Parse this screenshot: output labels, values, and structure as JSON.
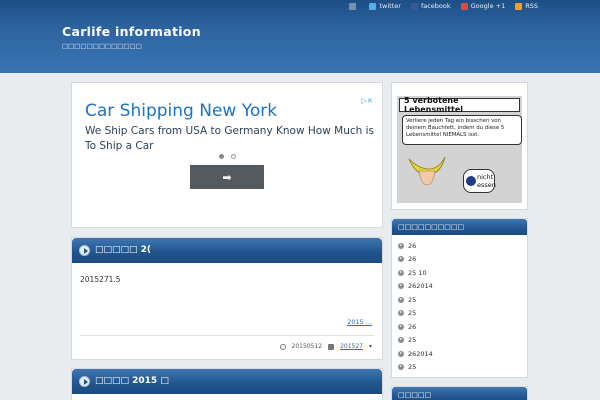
{
  "site": {
    "title": "Carlife information",
    "description": "□□□□□□□□□□□□□"
  },
  "topbar": [
    {
      "label": "",
      "icon": "rss-square-icon",
      "color": "#7a8fa8"
    },
    {
      "label": "twitter",
      "icon": "twitter-icon",
      "color": "#55acee"
    },
    {
      "label": "facebook",
      "icon": "facebook-icon",
      "color": "#3b5998"
    },
    {
      "label": "Google +1",
      "icon": "google-plus-icon",
      "color": "#dd4b39"
    },
    {
      "label": "RSS",
      "icon": "rss-icon",
      "color": "#f59d2a"
    }
  ],
  "ad": {
    "title": "Car Shipping New York",
    "body": "We Ship Cars from USA to Germany Know How Much is To Ship a Car",
    "button_label": "➡",
    "choice_label": "▷✕"
  },
  "article": {
    "title": "□□□□□ 2(",
    "text": "2015271.5",
    "more_link": "2015 ...",
    "date": "20150512",
    "tag": "201527",
    "tag_suffix": "▾"
  },
  "article2": {
    "title": "□□□□ 2015 □"
  },
  "side_ad": {
    "title": "5 verbotene Lebensmittel",
    "text": "Verliere jeden Tag ein bisschen von deinem Bauchfett, indem du diese 5 Lebensmittel NIEMALS isst.",
    "cta": "nicht essen"
  },
  "widget": {
    "title": "□□□□□□□□□□",
    "items": [
      "26",
      "26",
      "25  10",
      "262014",
      "25",
      "25",
      "26",
      "25",
      "262014",
      "25"
    ]
  },
  "widget2": {
    "title": "□□□□□"
  }
}
